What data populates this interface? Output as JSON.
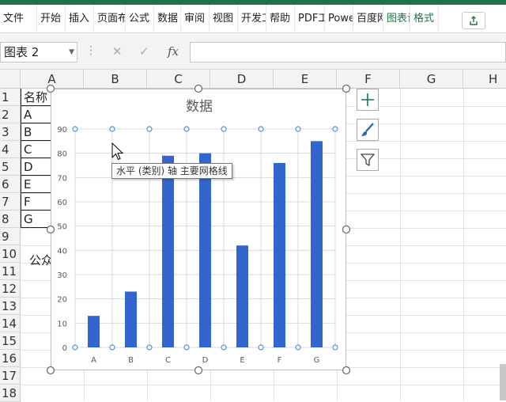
{
  "ribbon": {
    "tabs": [
      "文件",
      "开始",
      "插入",
      "页面布局",
      "公式",
      "数据",
      "审阅",
      "视图",
      "开发工具",
      "帮助",
      "PDF工具集",
      "Power Pivot",
      "百度网盘",
      "图表设计",
      "格式"
    ]
  },
  "formula_bar": {
    "name_box": "图表 2",
    "fx_label": "fx",
    "value": ""
  },
  "sheet": {
    "columns": [
      "A",
      "B",
      "C",
      "D",
      "E",
      "F",
      "G",
      "H"
    ],
    "rows": [
      "1",
      "2",
      "3",
      "4",
      "5",
      "6",
      "7",
      "8",
      "9",
      "10",
      "11",
      "12",
      "13",
      "14",
      "15",
      "16",
      "17",
      "18"
    ],
    "table_header": "名称",
    "table_names": [
      "A",
      "B",
      "C",
      "D",
      "E",
      "F",
      "G"
    ],
    "note_text": "公众"
  },
  "chart_data": {
    "type": "bar",
    "title": "数据",
    "categories": [
      "A",
      "B",
      "C",
      "D",
      "E",
      "F",
      "G"
    ],
    "values": [
      13,
      23,
      79,
      80,
      42,
      76,
      85
    ],
    "yticks": [
      "0",
      "10",
      "20",
      "30",
      "40",
      "50",
      "60",
      "70",
      "80",
      "90"
    ],
    "ylim": [
      0,
      90
    ],
    "xlabel": "",
    "ylabel": "",
    "grid": true,
    "bar_color": "#3366cc"
  },
  "tooltip": "水平 (类别) 轴 主要网格线",
  "colors": {
    "excel_green": "#217346",
    "selection_handle": "#4a90d9"
  }
}
